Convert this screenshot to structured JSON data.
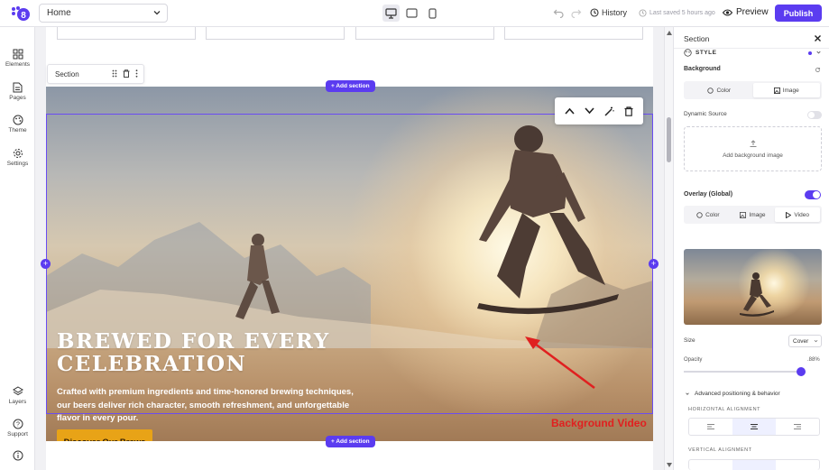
{
  "topbar": {
    "page_select": "Home",
    "history_label": "History",
    "saved_label": "Last saved 5 hours ago",
    "preview_label": "Preview",
    "publish_label": "Publish"
  },
  "rail": {
    "items": [
      {
        "label": "Elements",
        "icon": "grid-icon"
      },
      {
        "label": "Pages",
        "icon": "page-icon"
      },
      {
        "label": "Theme",
        "icon": "palette-icon"
      },
      {
        "label": "Settings",
        "icon": "gear-icon"
      },
      {
        "label": "Layers",
        "icon": "layers-icon"
      },
      {
        "label": "Support",
        "icon": "help-icon"
      }
    ]
  },
  "canvas": {
    "section_label": "Section",
    "add_section_label": "+ Add section",
    "hero": {
      "title": "BREWED FOR EVERY CELEBRATION",
      "description": "Crafted with premium ingredients and time-honored brewing techniques, our beers deliver rich character, smooth refreshment, and unforgettable flavor in every pour.",
      "button_label": "Discover Our Brews"
    },
    "annotation": "Background Video"
  },
  "panel": {
    "title": "Section",
    "style_label": "STYLE",
    "background_label": "Background",
    "bg_tabs": [
      "Color",
      "Image"
    ],
    "dynamic_source_label": "Dynamic Source",
    "add_bg_image_label": "Add background image",
    "overlay_label": "Overlay (Global)",
    "overlay_tabs": [
      "Color",
      "Image",
      "Video"
    ],
    "size_label": "Size",
    "size_value": "Cover",
    "opacity_label": "Opacity",
    "opacity_value": ".88%",
    "advanced_label": "Advanced positioning & behavior",
    "h_align_label": "HORIZONTAL ALIGNMENT",
    "v_align_label": "VERTICAL ALIGNMENT"
  },
  "colors": {
    "accent": "#5b3cf0",
    "cta": "#e8a317",
    "annotation": "#e02020"
  }
}
